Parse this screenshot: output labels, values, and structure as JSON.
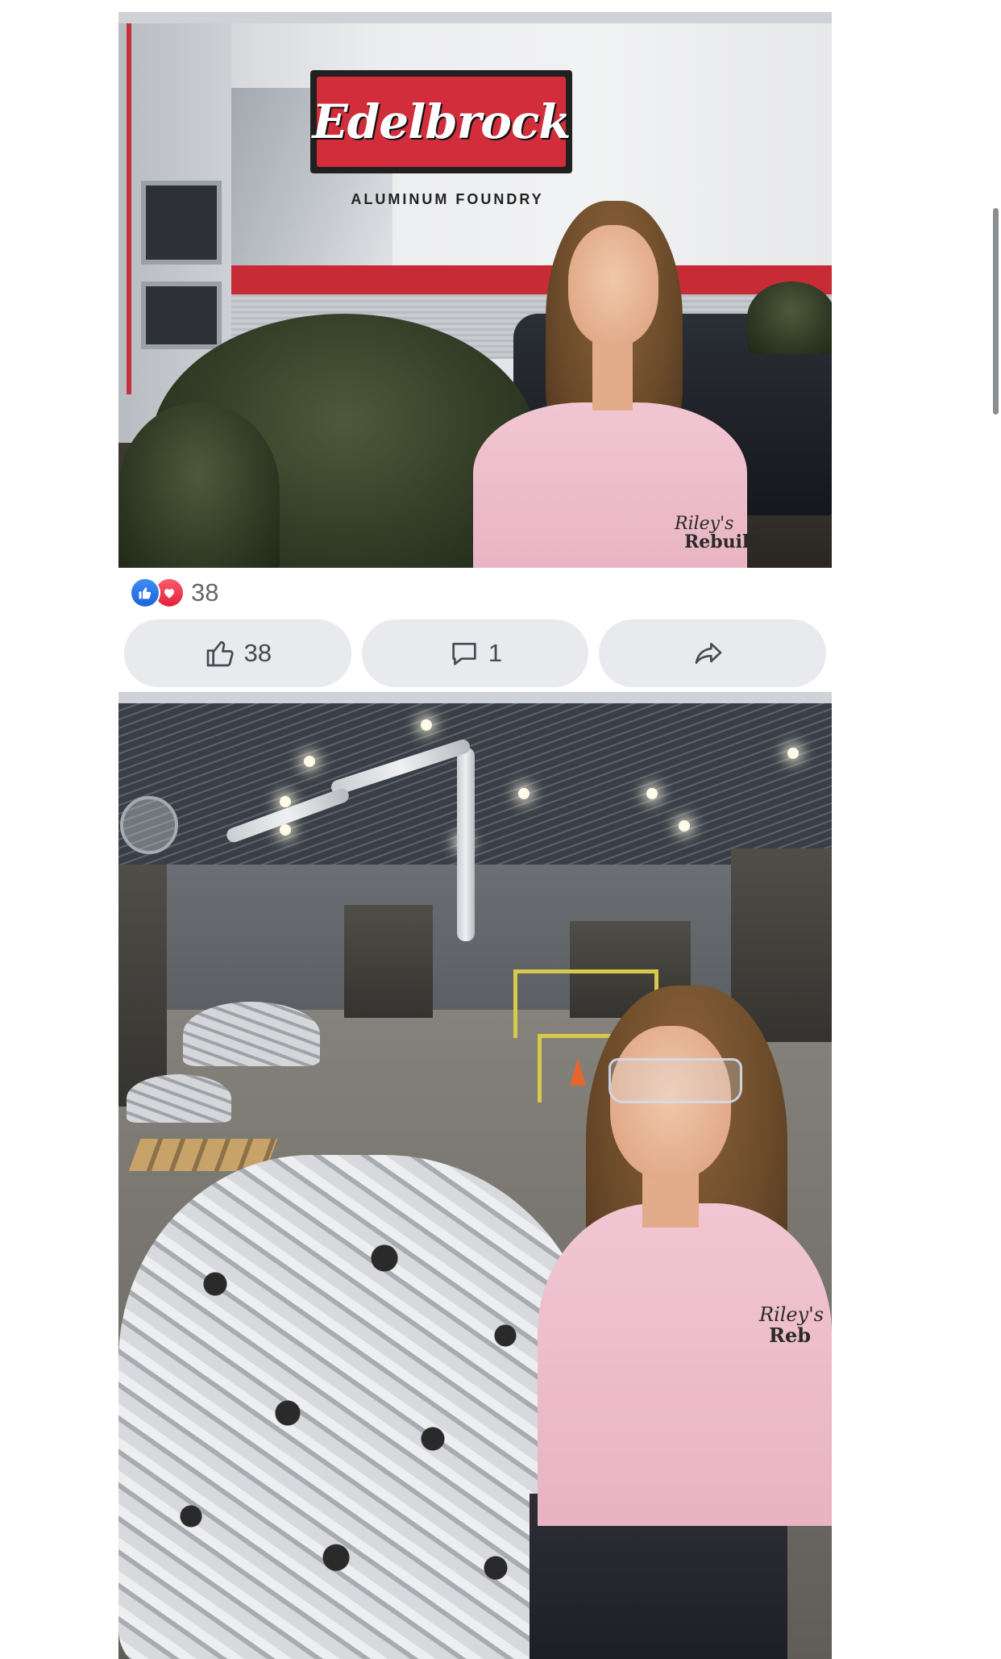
{
  "post_photos": [
    {
      "sign_text": "Edelbrock",
      "sign_subtext": "ALUMINUM   FOUNDRY",
      "shirt_text_line1": "Riley's",
      "shirt_text_line2": "Rebuild"
    },
    {
      "shirt_text_line1": "Riley's",
      "shirt_text_line2": "Reb"
    }
  ],
  "reactions": {
    "icons": [
      "like-icon",
      "love-icon"
    ],
    "count": "38"
  },
  "actions": {
    "like_count": "38",
    "comment_count": "1",
    "share_label": ""
  },
  "colors": {
    "like_blue": "#1a65d8",
    "love_red": "#e0213a",
    "button_bg": "#e9eaed",
    "text_gray": "#65676b"
  }
}
